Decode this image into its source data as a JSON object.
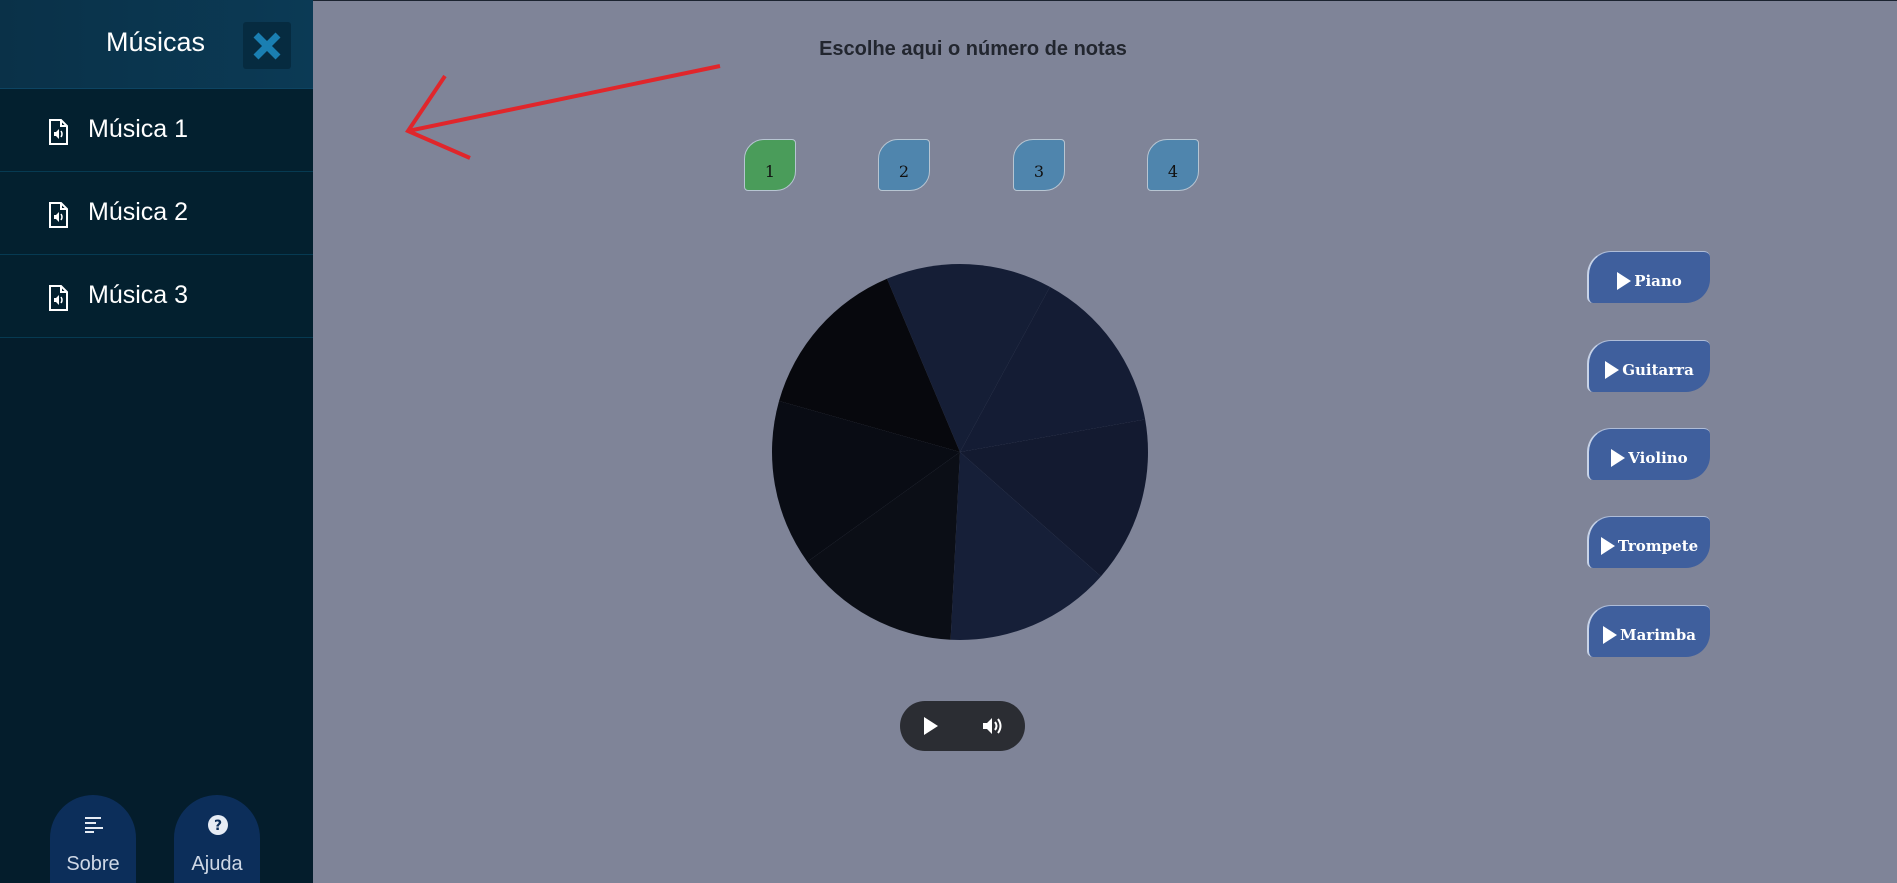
{
  "sidebar": {
    "title": "Músicas",
    "items": [
      {
        "label": "Música 1"
      },
      {
        "label": "Música 2"
      },
      {
        "label": "Música 3"
      }
    ],
    "footer": {
      "about_label": "Sobre",
      "help_label": "Ajuda"
    }
  },
  "main": {
    "notes_title": "Escolhe aqui o número de notas",
    "note_buttons": [
      {
        "label": "1",
        "color": "#4a9c5a",
        "selected": true
      },
      {
        "label": "2",
        "color": "#4f85ad"
      },
      {
        "label": "3",
        "color": "#4f85ad"
      },
      {
        "label": "4",
        "color": "#4f85ad"
      }
    ],
    "instruments": [
      {
        "label": "Piano"
      },
      {
        "label": "Guitarra"
      },
      {
        "label": "Violino"
      },
      {
        "label": "Trompete"
      },
      {
        "label": "Marimba"
      }
    ],
    "wheel_segment_colors": [
      "#151e36",
      "#141c34",
      "#131a30",
      "#161f38",
      "#0b0e16",
      "#090c14",
      "#07080d"
    ],
    "icons": {
      "close": "close-icon",
      "music_file": "music-file-icon",
      "about": "align-left-icon",
      "help": "question-circle-icon",
      "play": "play-icon",
      "volume": "volume-icon"
    }
  },
  "colors": {
    "background": "#7f8498",
    "sidebar": "#041d2c",
    "instrument_button": "#3f5f9d",
    "annotation_arrow": "#e0262b"
  }
}
